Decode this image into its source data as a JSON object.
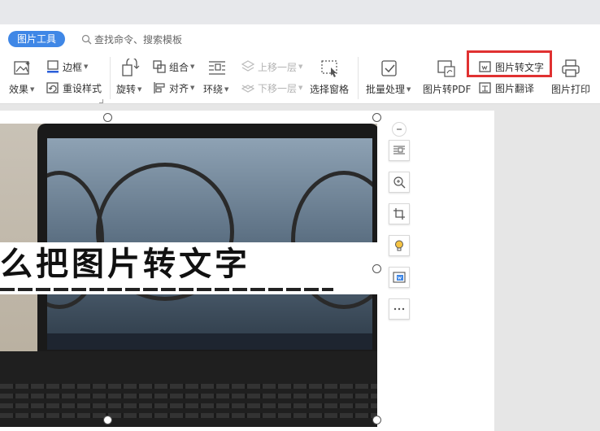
{
  "tab": {
    "active_label": "图片工具"
  },
  "search": {
    "placeholder": "查找命令、搜索模板"
  },
  "ribbon": {
    "effects": "效果",
    "border": "边框",
    "reset_style": "重设样式",
    "rotate": "旋转",
    "group": "组合",
    "align": "对齐",
    "wrap": "环绕",
    "bring_forward": "上移一层",
    "send_backward": "下移一层",
    "selection_pane": "选择窗格",
    "batch": "批量处理",
    "to_pdf": "图片转PDF",
    "to_text": "图片转文字",
    "translate": "图片翻译",
    "print": "图片打印"
  },
  "image": {
    "banner_text": "么把图片转文字"
  },
  "colors": {
    "accent": "#3f87e6",
    "highlight": "#e03131"
  },
  "side_tools": [
    "collapse-icon",
    "layout-icon",
    "zoom-icon",
    "crop-icon",
    "bulb-icon",
    "convert-icon",
    "more-icon"
  ]
}
